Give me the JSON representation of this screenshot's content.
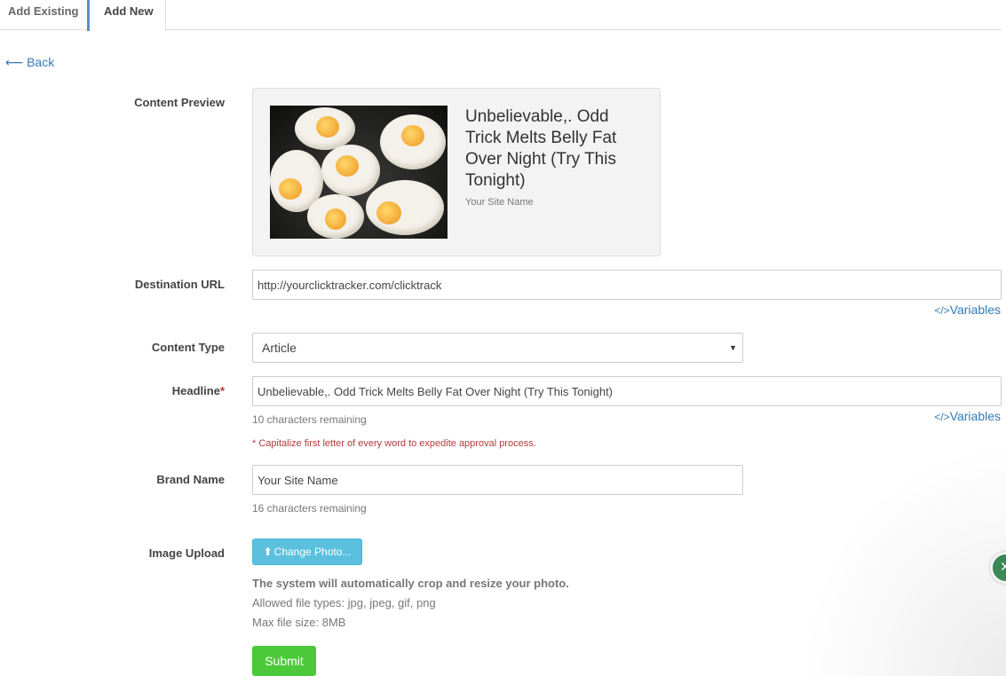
{
  "tabs": [
    {
      "label": "Add Existing",
      "active": false
    },
    {
      "label": "Add New",
      "active": true
    }
  ],
  "back": {
    "arrow": "⟵",
    "label": "Back"
  },
  "labels": {
    "content_preview": "Content Preview",
    "destination_url": "Destination URL",
    "content_type": "Content Type",
    "headline": "Headline",
    "headline_required": "*",
    "brand_name": "Brand Name",
    "image_upload": "Image Upload"
  },
  "preview": {
    "image_icon": "fried-eggs-image",
    "title": "Unbelievable,. Odd Trick Melts Belly Fat Over Night (Try This Tonight)",
    "brand": "Your Site Name"
  },
  "destination_url": {
    "value": "http://yourclicktracker.com/clicktrack"
  },
  "variables_link": {
    "icon": "</>",
    "label": "Variables"
  },
  "content_type": {
    "selected": "Article"
  },
  "headline": {
    "value": "Unbelievable,. Odd Trick Melts Belly Fat Over Night (Try This Tonight)",
    "remaining": "10 characters remaining",
    "warning": "* Capitalize first letter of every word to expedite approval process."
  },
  "brand_name": {
    "value": "Your Site Name",
    "remaining": "16 characters remaining"
  },
  "image_upload": {
    "button_label": "Change Photo...",
    "note_bold": "The system will automatically crop and resize your photo.",
    "allowed_types": "Allowed file types: jpg, jpeg, gif, png",
    "max_size": "Max file size: 8MB"
  },
  "submit_label": "Submit",
  "colors": {
    "link": "#337ab7",
    "info_button": "#5bc0de",
    "submit_button": "#4cc93a",
    "required": "#c9302c",
    "tab_accent": "#5a8fd0"
  }
}
